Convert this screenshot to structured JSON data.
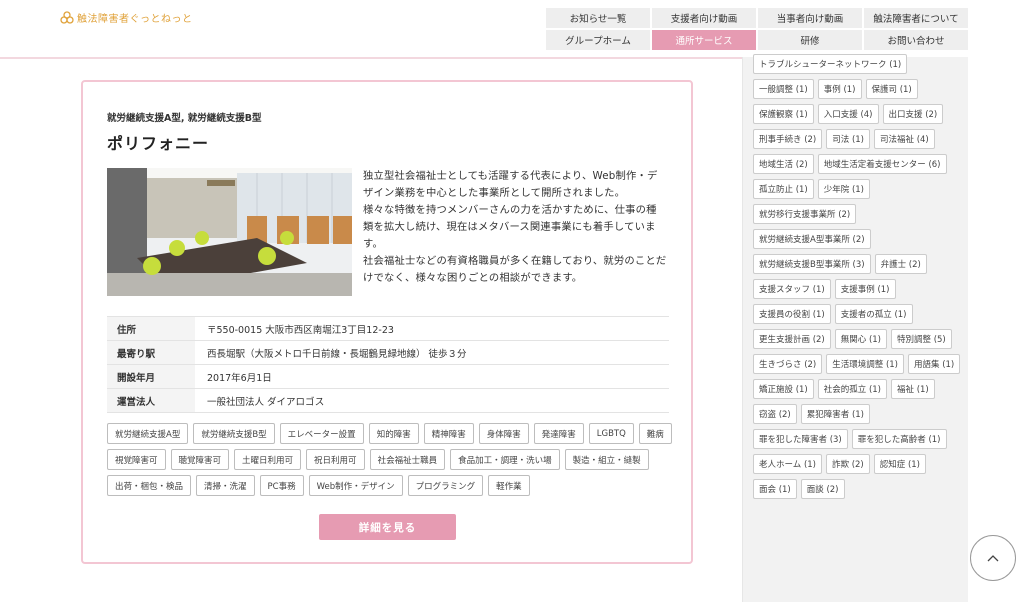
{
  "header": {
    "logo_text": "触法障害者ぐっとねっと",
    "nav": [
      {
        "label": "お知らせ一覧",
        "active": false
      },
      {
        "label": "支援者向け動画",
        "active": false
      },
      {
        "label": "当事者向け動画",
        "active": false
      },
      {
        "label": "触法障害者について",
        "active": false
      },
      {
        "label": "グループホーム",
        "active": false
      },
      {
        "label": "通所サービス",
        "active": true
      },
      {
        "label": "研修",
        "active": false
      },
      {
        "label": "お問い合わせ",
        "active": false
      }
    ]
  },
  "card": {
    "category": "就労継続支援A型, 就労継続支援B型",
    "title": "ポリフォニー",
    "description": [
      "独立型社会福祉士としても活躍する代表により、Web制作・デザイン業務を中心とした事業所として開所されました。",
      "様々な特徴を持つメンバーさんの力を活かすために、仕事の種類を拡大し続け、現在はメタバース関連事業にも着手しています。",
      "社会福祉士などの有資格職員が多く在籍しており、就労のことだけでなく、様々な困りごとの相談ができます。"
    ],
    "info": [
      {
        "key": "住所",
        "value": "〒550-0015 大阪市西区南堀江3丁目12-23"
      },
      {
        "key": "最寄り駅",
        "value": "西長堀駅（大阪メトロ千日前線・長堀鶴見緑地線） 徒歩３分"
      },
      {
        "key": "開設年月",
        "value": "2017年6月1日"
      },
      {
        "key": "運営法人",
        "value": "一般社団法人 ダイアロゴス"
      }
    ],
    "tags": [
      "就労継続支援A型",
      "就労継続支援B型",
      "エレベーター設置",
      "知的障害",
      "精神障害",
      "身体障害",
      "発達障害",
      "LGBTQ",
      "難病",
      "視覚障害可",
      "聴覚障害可",
      "土曜日利用可",
      "祝日利用可",
      "社会福祉士職員",
      "食品加工・調理・洗い場",
      "製造・組立・縫製",
      "出荷・梱包・検品",
      "清掃・洗濯",
      "PC事務",
      "Web制作・デザイン",
      "プログラミング",
      "軽作業"
    ],
    "detail_button": "詳細を見る"
  },
  "sidebar": {
    "tags": [
      "トラブルシューターネットワーク (1)",
      "一般調整 (1)",
      "事例 (1)",
      "保護司 (1)",
      "保護観察 (1)",
      "入口支援 (4)",
      "出口支援 (2)",
      "刑事手続き (2)",
      "司法 (1)",
      "司法福祉 (4)",
      "地域生活 (2)",
      "地域生活定着支援センター (6)",
      "孤立防止 (1)",
      "少年院 (1)",
      "就労移行支援事業所 (2)",
      "就労継続支援A型事業所 (2)",
      "就労継続支援B型事業所 (3)",
      "弁護士 (2)",
      "支援スタッフ (1)",
      "支援事例 (1)",
      "支援員の役割 (1)",
      "支援者の孤立 (1)",
      "更生支援計画 (2)",
      "無関心 (1)",
      "特別調整 (5)",
      "生きづらさ (2)",
      "生活環境調整 (1)",
      "用語集 (1)",
      "矯正施設 (1)",
      "社会的孤立 (1)",
      "福祉 (1)",
      "窃盗 (2)",
      "累犯障害者 (1)",
      "罪を犯した障害者 (3)",
      "罪を犯した高齢者 (1)",
      "老人ホーム (1)",
      "詐欺 (2)",
      "認知症 (1)",
      "面会 (1)",
      "面談 (2)"
    ]
  },
  "colors": {
    "accent": "#e69bb2",
    "card_border": "#f3c6d3",
    "logo": "#e0a23a"
  }
}
